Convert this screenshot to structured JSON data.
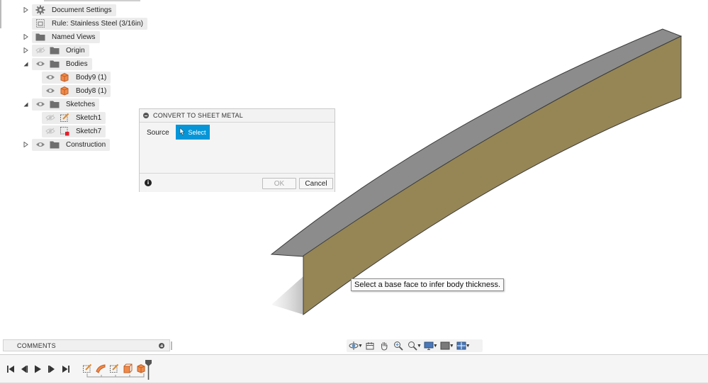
{
  "browser": {
    "items": [
      {
        "label": "Document Settings",
        "icon": "gear-icon"
      },
      {
        "label": "Rule: Stainless Steel (3/16in)",
        "icon": "sheet-metal-rule-icon"
      },
      {
        "label": "Named Views",
        "icon": "folder-icon"
      },
      {
        "label": "Origin",
        "icon": "folder-icon"
      },
      {
        "label": "Bodies",
        "icon": "folder-icon"
      },
      {
        "label": "Body9 (1)",
        "icon": "body-icon"
      },
      {
        "label": "Body8 (1)",
        "icon": "body-icon"
      },
      {
        "label": "Sketches",
        "icon": "folder-icon"
      },
      {
        "label": "Sketch1",
        "icon": "sketch-icon"
      },
      {
        "label": "Sketch7",
        "icon": "sketch-warning-icon"
      },
      {
        "label": "Construction",
        "icon": "folder-icon"
      }
    ]
  },
  "dialog": {
    "title": "CONVERT TO SHEET METAL",
    "source_label": "Source",
    "select_label": "Select",
    "ok_label": "OK",
    "cancel_label": "Cancel"
  },
  "tooltip": {
    "text": "Select a base face to infer body thickness."
  },
  "comments": {
    "title": "COMMENTS"
  },
  "navbar": {
    "icons": [
      "orbit-icon",
      "look-at-icon",
      "pan-icon",
      "zoom-icon",
      "zoom-window-icon",
      "display-settings-icon",
      "visual-style-icon",
      "viewports-icon"
    ]
  },
  "timeline": {
    "controls": [
      "skip-to-start-icon",
      "step-back-icon",
      "play-icon",
      "step-forward-icon",
      "skip-to-end-icon"
    ],
    "features": [
      "sketch-feature-icon",
      "surface-feature-icon",
      "sketch-feature-icon",
      "extrude-feature-icon",
      "convert-feature-icon"
    ]
  },
  "colors": {
    "accent": "#0696d7",
    "body_face": "#968656",
    "body_top": "#8c8c8c",
    "body_lip": "#d9d9d9"
  }
}
